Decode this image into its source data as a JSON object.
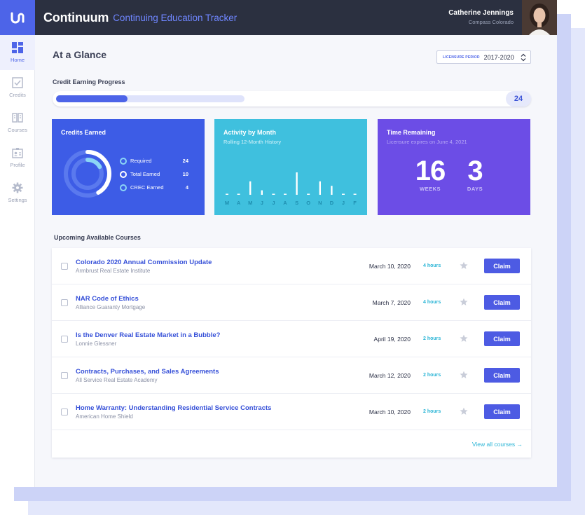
{
  "brand": {
    "name": "Continuum",
    "subtitle": "Continuing Education Tracker"
  },
  "user": {
    "name": "Catherine Jennings",
    "organization": "Compass Colorado"
  },
  "sidebar": {
    "items": [
      {
        "label": "Home",
        "icon": "home-grid-icon",
        "active": true
      },
      {
        "label": "Credits",
        "icon": "checkbox-icon",
        "active": false
      },
      {
        "label": "Courses",
        "icon": "book-icon",
        "active": false
      },
      {
        "label": "Profile",
        "icon": "id-card-icon",
        "active": false
      },
      {
        "label": "Settings",
        "icon": "gear-icon",
        "active": false
      }
    ]
  },
  "page": {
    "title": "At a Glance",
    "period_label": "LICENSURE PERIOD",
    "period_value": "2017-2020"
  },
  "progress": {
    "label": "Credit Earning Progress",
    "value": "24",
    "fill_fraction": 0.38
  },
  "credits_card": {
    "title": "Credits Earned",
    "legend": [
      {
        "label": "Required",
        "value": "24"
      },
      {
        "label": "Total Earned",
        "value": "10"
      },
      {
        "label": "CREC Earned",
        "value": "4"
      }
    ],
    "total_fraction": 0.417,
    "crec_fraction": 0.167
  },
  "activity_card": {
    "title": "Activity by Month",
    "subtitle": "Rolling 12-Month History"
  },
  "chart_data": {
    "type": "bar",
    "title": "Activity by Month",
    "subtitle": "Rolling 12-Month History",
    "categories": [
      "M",
      "A",
      "M",
      "J",
      "J",
      "A",
      "S",
      "O",
      "N",
      "D",
      "J",
      "F"
    ],
    "values": [
      0,
      0,
      6,
      2,
      0,
      0,
      10,
      0,
      6,
      4,
      0,
      0
    ],
    "xlabel": "",
    "ylabel": "",
    "grid": false
  },
  "time_card": {
    "title": "Time Remaining",
    "subtitle": "Licensure expires on June 4, 2021",
    "weeks_value": "16",
    "weeks_label": "WEEKS",
    "days_value": "3",
    "days_label": "DAYS"
  },
  "courses": {
    "section_title": "Upcoming Available Courses",
    "claim_label": "Claim",
    "view_all": "View all courses →",
    "items": [
      {
        "title": "Colorado 2020 Annual Commission Update",
        "provider": "Armbrust Real Estate Institute",
        "date": "March 10, 2020",
        "hours": "4 hours"
      },
      {
        "title": "NAR Code of Ethics",
        "provider": "Alliance Guaranty Mortgage",
        "date": "March 7, 2020",
        "hours": "4 hours"
      },
      {
        "title": "Is the Denver Real Estate Market in a Bubble?",
        "provider": "Lonnie Glessner",
        "date": "April 19, 2020",
        "hours": "2 hours"
      },
      {
        "title": "Contracts, Purchases, and Sales Agreements",
        "provider": "All Service Real Estate Academy",
        "date": "March 12, 2020",
        "hours": "2 hours"
      },
      {
        "title": "Home Warranty: Understanding Residential Service Contracts",
        "provider": "American Home Shield",
        "date": "March 10, 2020",
        "hours": "2 hours"
      }
    ]
  },
  "colors": {
    "accent": "#4d64e8",
    "header_bg": "#2b3040",
    "credits_card": "#3d5ce6",
    "activity_card": "#3fc0de",
    "time_card": "#6c4de6",
    "hours_text": "#2bb5d6"
  }
}
